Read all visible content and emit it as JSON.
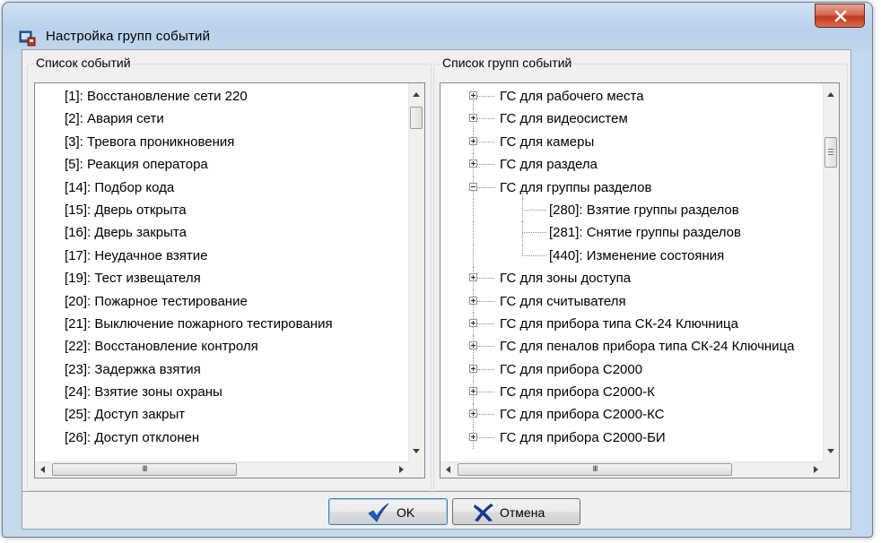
{
  "window": {
    "title": "Настройка групп событий",
    "close_icon": "close-icon"
  },
  "left_panel": {
    "label": "Список событий",
    "items": [
      "[1]: Восстановление сети 220",
      "[2]: Авария сети",
      "[3]: Тревога проникновения",
      "[5]: Реакция оператора",
      "[14]: Подбор кода",
      "[15]: Дверь открыта",
      "[16]: Дверь закрыта",
      "[17]: Неудачное взятие",
      "[19]: Тест извещателя",
      "[20]: Пожарное тестирование",
      "[21]: Выключение пожарного тестирования",
      "[22]: Восстановление контроля",
      "[23]: Задержка взятия",
      "[24]: Взятие зоны охраны",
      "[25]: Доступ закрыт",
      "[26]: Доступ отклонен"
    ],
    "hscroll_grip": "III"
  },
  "right_panel": {
    "label": "Список групп событий",
    "nodes": [
      {
        "label": "ГС для рабочего места",
        "level": 0,
        "state": "collapsed"
      },
      {
        "label": "ГС для видеосистем",
        "level": 0,
        "state": "collapsed"
      },
      {
        "label": "ГС для камеры",
        "level": 0,
        "state": "collapsed"
      },
      {
        "label": "ГС для раздела",
        "level": 0,
        "state": "collapsed"
      },
      {
        "label": "ГС для группы разделов",
        "level": 0,
        "state": "expanded"
      },
      {
        "label": "[280]: Взятие группы разделов",
        "level": 1,
        "state": "leaf"
      },
      {
        "label": "[281]: Снятие группы разделов",
        "level": 1,
        "state": "leaf"
      },
      {
        "label": "[440]: Изменение состояния",
        "level": 1,
        "state": "leaf"
      },
      {
        "label": "ГС для зоны доступа",
        "level": 0,
        "state": "collapsed"
      },
      {
        "label": "ГС для считывателя",
        "level": 0,
        "state": "collapsed"
      },
      {
        "label": "ГС для прибора типа СК-24 Ключница",
        "level": 0,
        "state": "collapsed"
      },
      {
        "label": "ГС для пеналов прибора типа СК-24 Ключница",
        "level": 0,
        "state": "collapsed"
      },
      {
        "label": "ГС для прибора С2000",
        "level": 0,
        "state": "collapsed"
      },
      {
        "label": "ГС для прибора С2000-К",
        "level": 0,
        "state": "collapsed"
      },
      {
        "label": "ГС для прибора С2000-КС",
        "level": 0,
        "state": "collapsed"
      },
      {
        "label": "ГС для прибора С2000-БИ",
        "level": 0,
        "state": "collapsed"
      }
    ],
    "hscroll_grip": "III"
  },
  "buttons": {
    "ok_label": "OK",
    "cancel_label": "Отмена",
    "ok_icon": "checkmark-icon",
    "cancel_icon": "cross-icon"
  },
  "colors": {
    "check_blue": "#1a5fc4",
    "cross_blue": "#163a8a",
    "close_red": "#c2391c"
  }
}
